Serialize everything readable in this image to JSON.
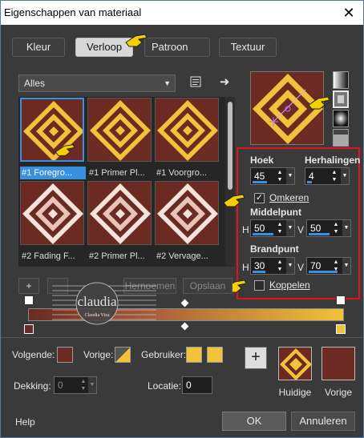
{
  "window": {
    "title": "Eigenschappen van materiaal",
    "close_glyph": "✕"
  },
  "tabs": [
    {
      "label": "Kleur",
      "active": false
    },
    {
      "label": "Verloop",
      "active": true
    },
    {
      "label": "Patroon",
      "active": false
    },
    {
      "label": "Textuur",
      "active": false
    }
  ],
  "library": {
    "category": "Alles",
    "gradients": [
      {
        "caption": "#1 Foregro...",
        "selected": true,
        "style": "fg"
      },
      {
        "caption": "#1 Primer Pl...",
        "selected": false,
        "style": "fg"
      },
      {
        "caption": "#1 Voorgro...",
        "selected": false,
        "style": "fg"
      },
      {
        "caption": "#2 Fading F...",
        "selected": false,
        "style": "fade"
      },
      {
        "caption": "#2 Primer Pl...",
        "selected": false,
        "style": "fade"
      },
      {
        "caption": "#2 Vervage...",
        "selected": false,
        "style": "fade"
      }
    ],
    "add_label": "+",
    "rename_label": "Hernoemen",
    "save_label": "Opslaan"
  },
  "settings": {
    "angle_label": "Hoek",
    "angle_value": "45",
    "repeats_label": "Herhalingen",
    "repeats_value": "4",
    "invert_label": "Omkeren",
    "invert_checked": true,
    "center_label": "Middelpunt",
    "center_h_axis": "H",
    "center_h": "50",
    "center_v_axis": "V",
    "center_v": "50",
    "focal_label": "Brandpunt",
    "focal_h_axis": "H",
    "focal_h": "30",
    "focal_v_axis": "V",
    "focal_v": "70",
    "link_label": "Koppelen",
    "link_checked": false
  },
  "gradient_editor": {
    "watermark_text": "claudia",
    "watermark_subtext": "Claudia Viza"
  },
  "stops": {
    "next_label": "Volgende:",
    "prev_label": "Vorige:",
    "user_label": "Gebruiker:",
    "opacity_label": "Dekking:",
    "opacity_value": "0",
    "location_label": "Locatie:",
    "location_value": "0"
  },
  "materials": {
    "current_label": "Huidige",
    "previous_label": "Vorige"
  },
  "buttons": {
    "help": "Help",
    "ok": "OK",
    "cancel": "Annuleren"
  },
  "colors": {
    "brown": "#6b2a22",
    "gold": "#f2c23a",
    "accent_blue": "#3a8fe0",
    "highlight_red": "#e0121b"
  }
}
